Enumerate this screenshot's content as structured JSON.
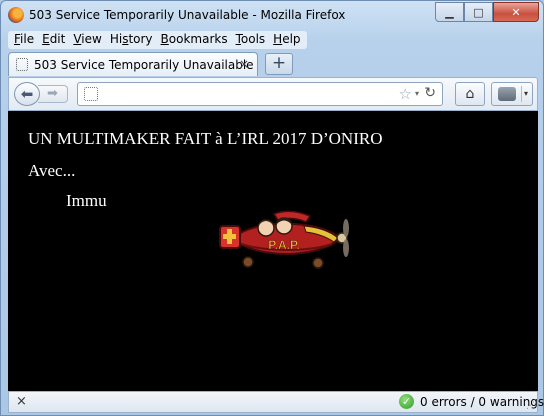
{
  "window": {
    "title": "503 Service Temporarily Unavailable - Mozilla Firefox",
    "controls": {
      "minimize": "▁",
      "maximize": "□",
      "close": "✕"
    }
  },
  "menubar": {
    "items": [
      {
        "pre": "",
        "key": "F",
        "post": "ile"
      },
      {
        "pre": "",
        "key": "E",
        "post": "dit"
      },
      {
        "pre": "",
        "key": "V",
        "post": "iew"
      },
      {
        "pre": "Hi",
        "key": "s",
        "post": "tory"
      },
      {
        "pre": "",
        "key": "B",
        "post": "ookmarks"
      },
      {
        "pre": "",
        "key": "T",
        "post": "ools"
      },
      {
        "pre": "",
        "key": "H",
        "post": "elp"
      }
    ]
  },
  "tabs": [
    {
      "label": "503 Service Temporarily Unavailable",
      "close": "×"
    }
  ],
  "newtab": {
    "label": "+"
  },
  "navbar": {
    "back": "⬅",
    "forward": "➡",
    "url_value": "",
    "star": "☆",
    "dropdown": "▾",
    "reload": "↻",
    "home": "⌂",
    "addon_arrow": "▾",
    "icons": [
      "back-arrow-icon",
      "forward-arrow-icon",
      "site-identity-icon",
      "bookmark-star-icon",
      "reload-icon",
      "home-icon",
      "addon-icon"
    ]
  },
  "content": {
    "line1": "UN MULTIMAKER FAIT à L’IRL 2017 D’ONIRO",
    "line2": "Avec...",
    "line3": "Immu",
    "plane_text": "P.A.P.",
    "background": "#000000",
    "text_color": "#ffffff"
  },
  "statusbar": {
    "close": "×",
    "check": "✓",
    "validator": "0 errors / 0 warnings",
    "grip": "⋰"
  }
}
